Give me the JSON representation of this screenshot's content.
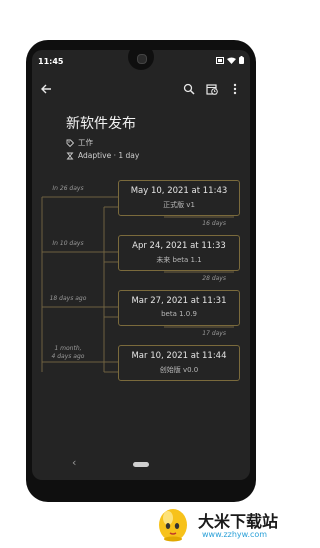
{
  "status_bar": {
    "time": "11:45"
  },
  "toolbar": {},
  "note": {
    "title": "新软件发布",
    "tag": "工作",
    "schedule": "Adaptive · 1 day"
  },
  "timeline": {
    "entries": [
      {
        "ago": "In 26 days",
        "date": "May 10, 2021 at 11:43",
        "label": "正式版 v1"
      },
      {
        "ago": "In 10 days",
        "date": "Apr 24, 2021 at 11:33",
        "label": "未来 beta 1.1"
      },
      {
        "ago": "18 days ago",
        "date": "Mar 27, 2021 at 11:31",
        "label": "beta 1.0.9"
      },
      {
        "ago_line1": "1 month,",
        "ago_line2": "4 days ago",
        "date": "Mar 10, 2021 at 11:44",
        "label": "创始版 v0.0"
      }
    ],
    "gaps": [
      "16 days",
      "28 days",
      "17 days"
    ]
  },
  "watermark": {
    "name": "大米下载站",
    "url": "www.zzhyw.com"
  },
  "colors": {
    "screen_bg": "#242424",
    "card_border": "#7a6a3c",
    "timeline_line": "#6e6140",
    "brand_url": "#2aa0d8"
  }
}
